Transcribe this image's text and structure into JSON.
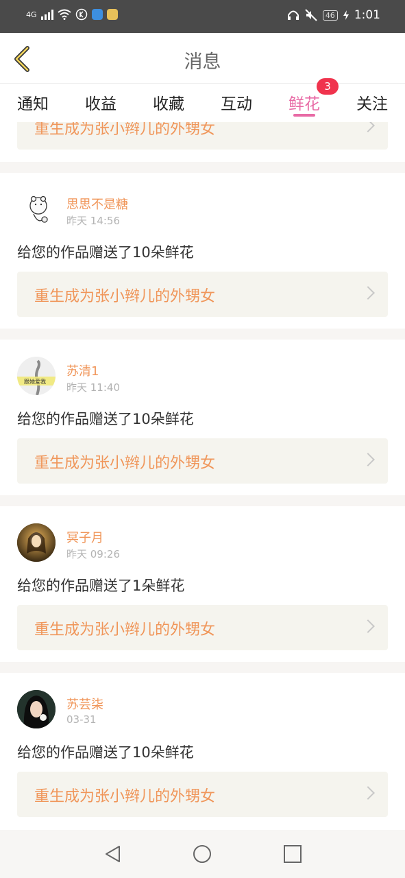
{
  "status": {
    "signal": "4G",
    "time": "1:01",
    "battery": "46"
  },
  "header": {
    "title": "消息"
  },
  "tabs": [
    {
      "label": "通知"
    },
    {
      "label": "收益"
    },
    {
      "label": "收藏"
    },
    {
      "label": "互动"
    },
    {
      "label": "鲜花",
      "badge": "3"
    },
    {
      "label": "关注"
    }
  ],
  "feed": {
    "partial_link": "重生成为张小辫儿的外甥女",
    "items": [
      {
        "name": "思思不是糖",
        "time": "昨天 14:56",
        "message": "给您的作品赠送了10朵鲜花",
        "work": "重生成为张小辫儿的外甥女"
      },
      {
        "name": "苏清1",
        "time": "昨天 11:40",
        "message": "给您的作品赠送了10朵鲜花",
        "work": "重生成为张小辫儿的外甥女",
        "avatar_caption": "跟她爱我"
      },
      {
        "name": "冥子月",
        "time": "昨天 09:26",
        "message": "给您的作品赠送了1朵鲜花",
        "work": "重生成为张小辫儿的外甥女"
      },
      {
        "name": "苏芸柒",
        "time": "03-31",
        "message": "给您的作品赠送了10朵鲜花",
        "work": "重生成为张小辫儿的外甥女"
      }
    ]
  },
  "colors": {
    "accent": "#e86aa5",
    "name": "#f0965a",
    "badge": "#f0334d",
    "link_bg": "#f5f4ee"
  }
}
